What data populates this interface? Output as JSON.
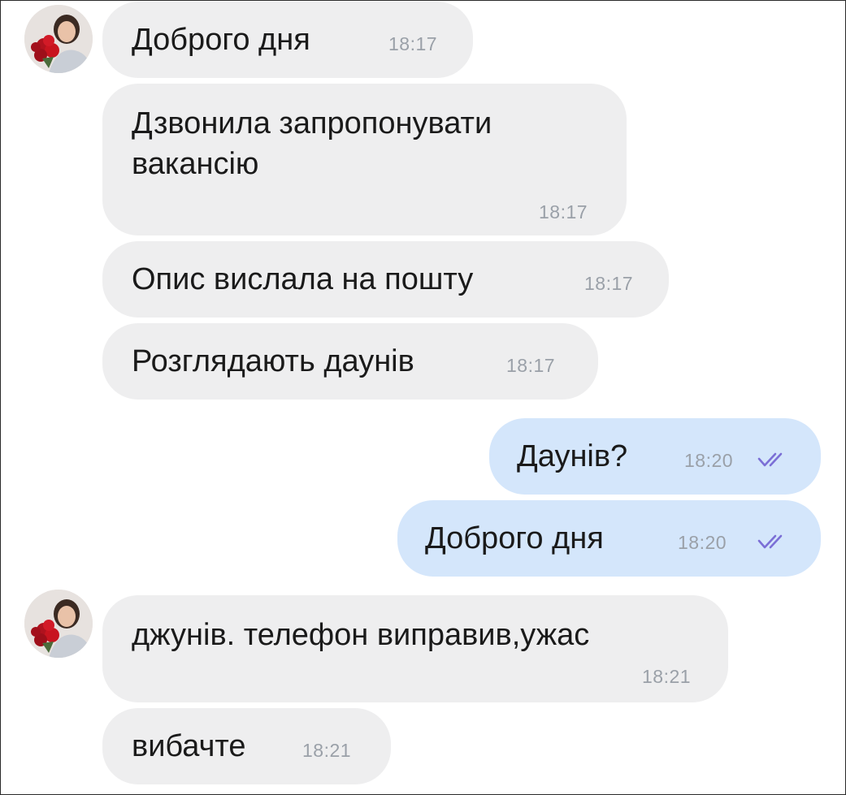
{
  "colors": {
    "incoming_bubble": "#eeeeef",
    "outgoing_bubble": "#d4e6fb",
    "text": "#1a1a1a",
    "timestamp": "#9aa0a8",
    "read_checkmark": "#7b6fd6"
  },
  "avatar": {
    "icon": "contact-avatar-photo-with-red-roses"
  },
  "messages": [
    {
      "direction": "incoming",
      "text": "Доброго дня",
      "time": "18:17"
    },
    {
      "direction": "incoming",
      "text": "Дзвонила запропонувати\nвакансію",
      "time": "18:17"
    },
    {
      "direction": "incoming",
      "text": "Опис вислала на пошту",
      "time": "18:17"
    },
    {
      "direction": "incoming",
      "text": "Розглядають даунів",
      "time": "18:17"
    },
    {
      "direction": "outgoing",
      "text": "Даунів?",
      "time": "18:20",
      "status_icon": "double-check-read-icon"
    },
    {
      "direction": "outgoing",
      "text": "Доброго дня",
      "time": "18:20",
      "status_icon": "double-check-read-icon"
    },
    {
      "direction": "incoming",
      "text": "джунів. телефон виправив,ужас",
      "time": "18:21"
    },
    {
      "direction": "incoming",
      "text": "вибачте",
      "time": "18:21"
    }
  ]
}
